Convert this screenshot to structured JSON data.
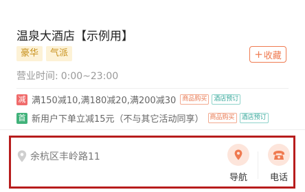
{
  "hotel": {
    "title": "温泉大酒店【示例用】",
    "tags": [
      "豪华",
      "气派"
    ],
    "favorite_label": "收藏",
    "hours_label": "营业时间:",
    "hours_value": "0:00~23:00"
  },
  "promotions": [
    {
      "icon_text": "减",
      "icon_color": "#f06b6b",
      "text": "满150减10,满180减20,满200减30",
      "badges": [
        "商品购买",
        "酒店预订"
      ]
    },
    {
      "icon_text": "首",
      "icon_color": "#41b27a",
      "text": "新用户下单立减15元（不与其它活动同享）",
      "badges": [
        "商品购买",
        "酒店预订"
      ]
    }
  ],
  "address": {
    "text": "余杭区丰岭路11",
    "icon": "map-pin-icon"
  },
  "actions": {
    "navigate_label": "导航",
    "call_label": "电话"
  },
  "colors": {
    "accent": "#ef7a50",
    "tag_bg": "#fdf2d6",
    "tag_text": "#c8921e",
    "highlight_border": "#b71c1c"
  }
}
